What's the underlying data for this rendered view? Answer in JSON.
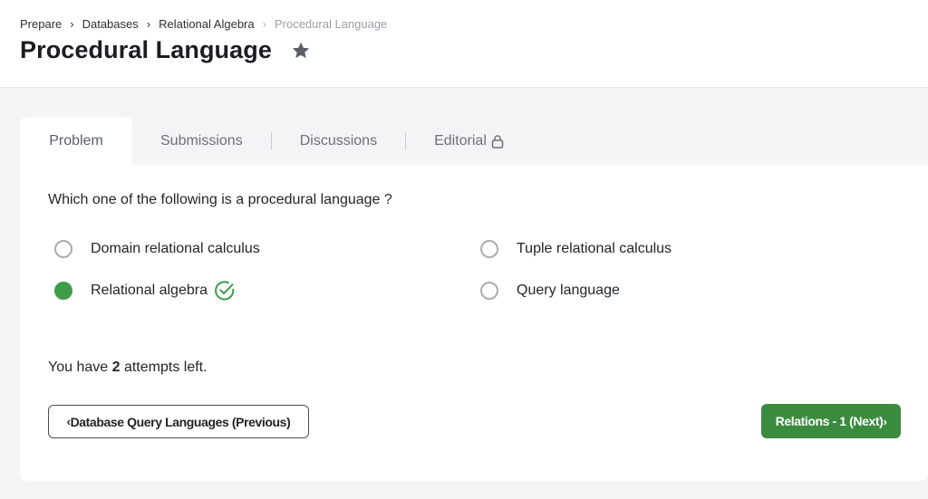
{
  "breadcrumb": {
    "items": [
      "Prepare",
      "Databases",
      "Relational Algebra",
      "Procedural Language"
    ]
  },
  "header": {
    "title": "Procedural Language",
    "star_icon": "star-icon"
  },
  "tabs": [
    {
      "label": "Problem",
      "active": true
    },
    {
      "label": "Submissions",
      "active": false
    },
    {
      "label": "Discussions",
      "active": false
    },
    {
      "label": "Editorial",
      "active": false,
      "icon": "lock-icon"
    }
  ],
  "question": {
    "text": "Which one of the following is a procedural language ?",
    "options": [
      {
        "label": "Domain relational calculus",
        "selected": false
      },
      {
        "label": "Tuple relational calculus",
        "selected": false
      },
      {
        "label": "Relational algebra",
        "selected": true,
        "correct": true
      },
      {
        "label": "Query language",
        "selected": false
      }
    ]
  },
  "attempts": {
    "prefix": "You have",
    "count": "2",
    "suffix": "attempts left."
  },
  "nav": {
    "prev_label": "Database Query Languages (Previous)",
    "next_label": "Relations - 1 (Next)"
  },
  "colors": {
    "accent_green": "#3b8b3f",
    "selected_radio": "#3f9d4a"
  }
}
